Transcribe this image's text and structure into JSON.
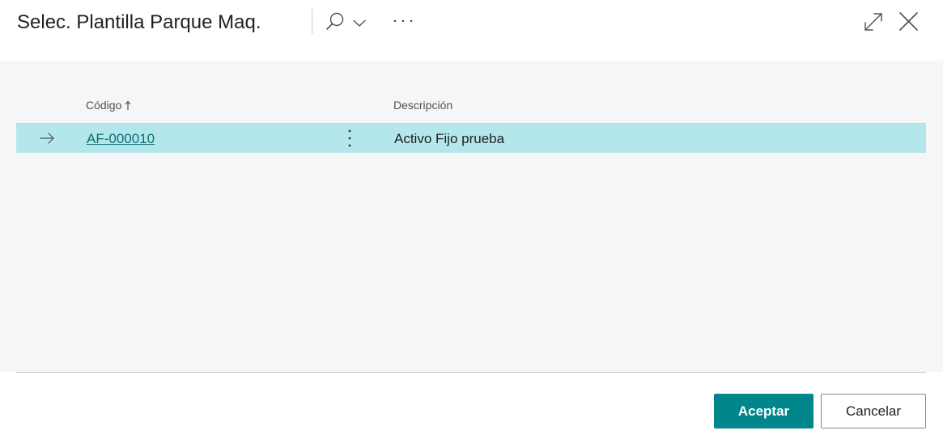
{
  "dialog": {
    "title": "Selec. Plantilla Parque Maq."
  },
  "toolbar": {
    "search_icon": "search-icon",
    "search_dropdown_icon": "chevron-down-icon",
    "more_icon": "more-horizontal-icon",
    "expand_icon": "expand-icon",
    "close_icon": "close-icon"
  },
  "table": {
    "columns": [
      {
        "label": "Código",
        "sorted": "ascending"
      },
      {
        "label": "Descripción"
      }
    ],
    "rows": [
      {
        "code": "AF-000010",
        "description": "Activo Fijo prueba",
        "selected": true
      }
    ]
  },
  "footer": {
    "ok_label": "Aceptar",
    "cancel_label": "Cancelar"
  },
  "colors": {
    "accent": "#00868b",
    "selected_row": "#b3e7ec",
    "link": "#0f6d73",
    "content_bg": "#f5f6f8"
  }
}
